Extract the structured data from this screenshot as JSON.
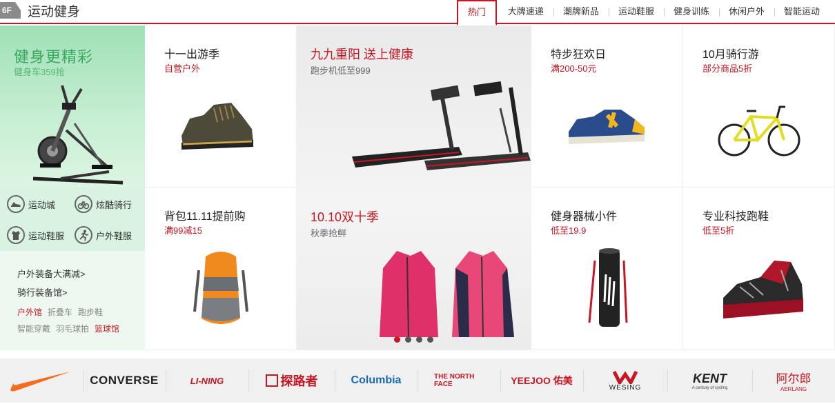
{
  "header": {
    "badge": "6F",
    "title": "运动健身",
    "tabs": [
      "热门",
      "大牌速递",
      "潮牌新品",
      "运动鞋服",
      "健身训练",
      "休闲户外",
      "智能运动"
    ]
  },
  "left": {
    "promo_title": "健身更精彩",
    "promo_sub": "健身车359抢",
    "quick_links": [
      "运动城",
      "炫酷骑行",
      "运动鞋服",
      "户外鞋服"
    ],
    "big_links": [
      "户外装备大满减>",
      "骑行装备馆>"
    ],
    "small_links_row1": [
      "户外馆",
      "折叠车",
      "跑步鞋"
    ],
    "small_links_row2": [
      "智能穿戴",
      "羽毛球拍",
      "篮球馆"
    ]
  },
  "products": [
    {
      "title": "十一出游季",
      "sub": "自营户外"
    },
    {
      "title": "特步狂欢日",
      "sub": "满200-50元"
    },
    {
      "title": "10月骑行游",
      "sub": "部分商品5折"
    },
    {
      "title": "背包11.11提前购",
      "sub": "满99减15"
    },
    {
      "title": "健身器械小件",
      "sub": "低至19.9"
    },
    {
      "title": "专业科技跑鞋",
      "sub": "低至5折"
    }
  ],
  "carousel": {
    "slide1_title": "九九重阳  送上健康",
    "slide1_sub": "跑步机低至999",
    "slide2_title": "10.10双十季",
    "slide2_sub": "秋季抢鲜",
    "dots": 4,
    "active_dot": 1
  },
  "brands": [
    "NIKE",
    "CONVERSE",
    "LI-NING",
    "探路者",
    "Columbia",
    "THE NORTH FACE",
    "YEEJOO 佑美",
    "WESING",
    "KENT",
    "阿尔郎"
  ],
  "brand_sublabels": {
    "wesing": "WESING",
    "kent": "A century of cycling",
    "aerlang": "AERLANG"
  },
  "colors": {
    "accent": "#c81623",
    "green": "#3aa861"
  },
  "icons": [
    "shoe-icon",
    "bike-icon",
    "jacket-icon",
    "runner-icon"
  ]
}
